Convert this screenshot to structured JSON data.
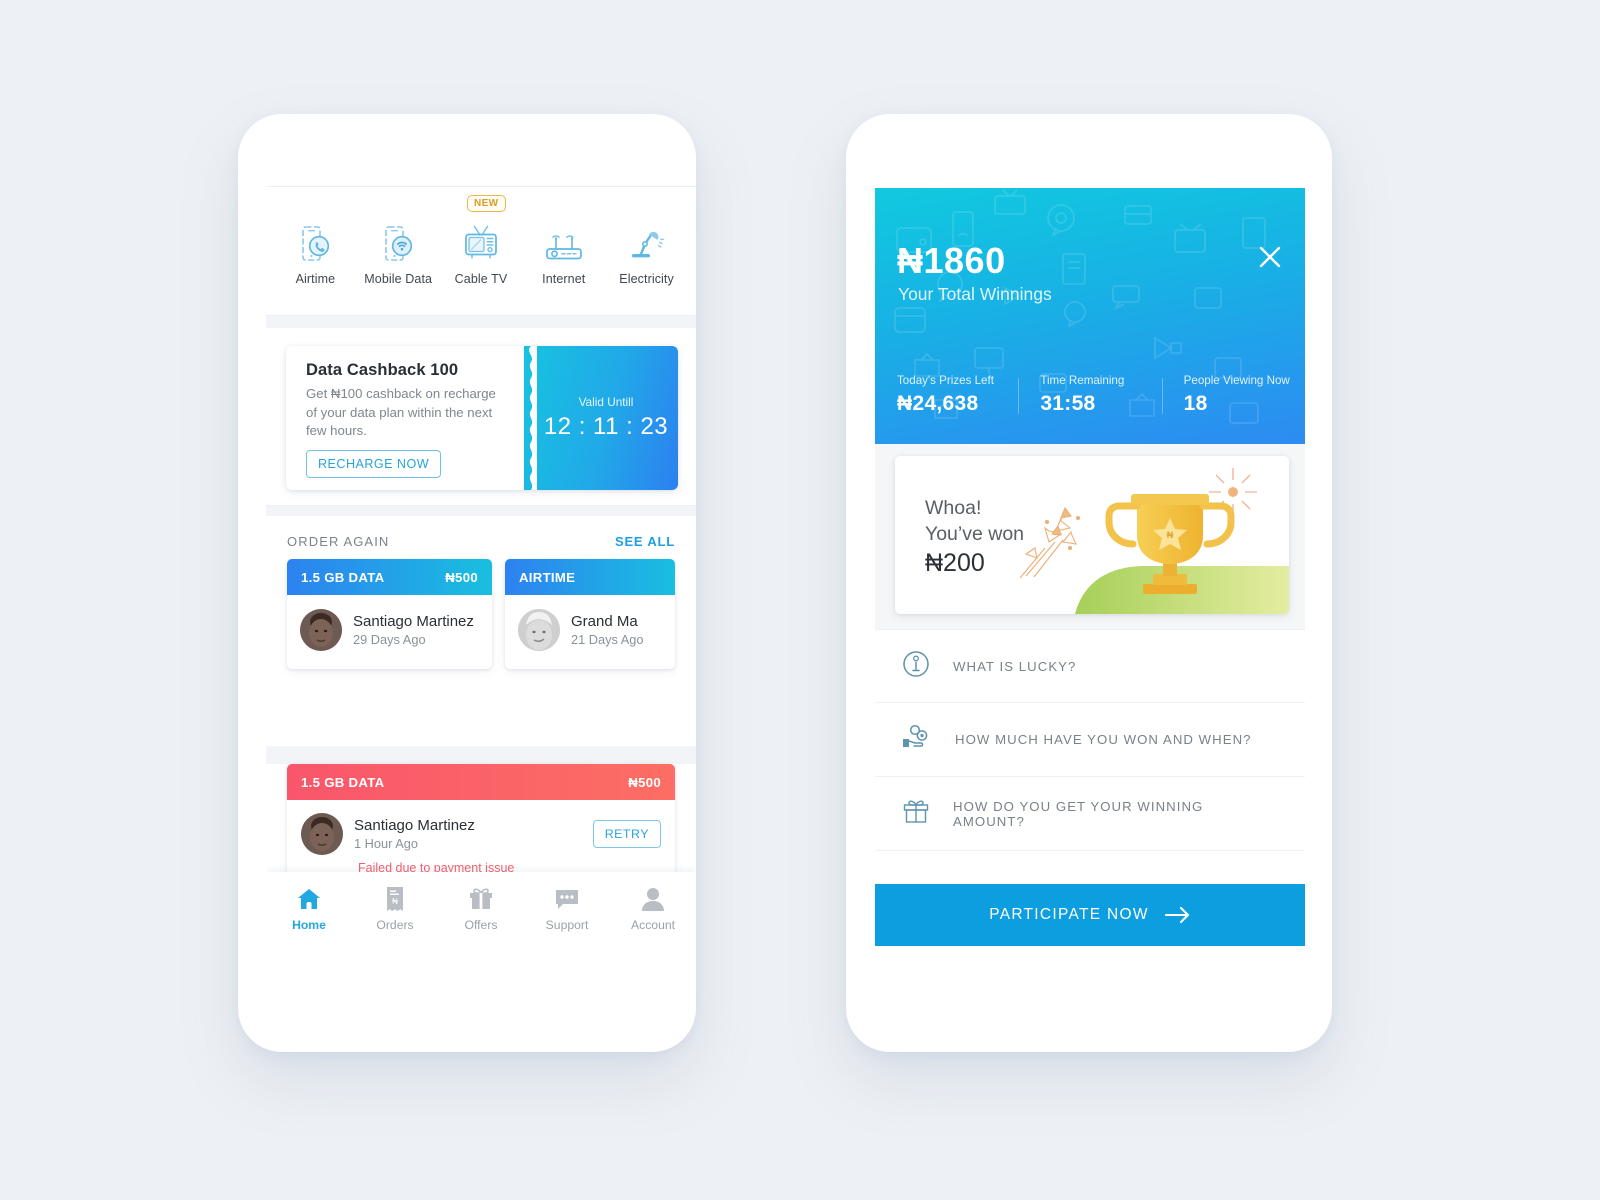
{
  "left_phone": {
    "services": [
      {
        "label": "Airtime",
        "icon": "phone-call-icon",
        "badge": null
      },
      {
        "label": "Mobile Data",
        "icon": "phone-wifi-icon",
        "badge": null
      },
      {
        "label": "Cable TV",
        "icon": "television-icon",
        "badge": "NEW"
      },
      {
        "label": "Internet",
        "icon": "router-icon",
        "badge": null
      },
      {
        "label": "Electricity",
        "icon": "desk-lamp-icon",
        "badge": null
      }
    ],
    "cashback": {
      "title": "Data Cashback 100",
      "description": "Get ₦100 cashback on recharge of your data plan within the next few hours.",
      "cta": "RECHARGE NOW",
      "valid_label": "Valid Untill",
      "countdown": "12 : 11 : 23"
    },
    "order_again": {
      "title": "ORDER AGAIN",
      "see_all": "SEE ALL",
      "cards": [
        {
          "type": "1.5 GB DATA",
          "amount": "₦500",
          "name": "Santiago Martinez",
          "time": "29 Days Ago",
          "status": "ok"
        },
        {
          "type": "AIRTIME",
          "amount": "",
          "name": "Grand Ma",
          "time": "21 Days Ago",
          "status": "ok"
        }
      ]
    },
    "failed_order": {
      "type": "1.5 GB DATA",
      "amount": "₦500",
      "name": "Santiago Martinez",
      "time": "1 Hour Ago",
      "error": "Failed due to payment issue",
      "retry_label": "RETRY"
    },
    "bottom_nav": [
      {
        "label": "Home",
        "icon": "home-icon",
        "active": true
      },
      {
        "label": "Orders",
        "icon": "receipt-icon",
        "active": false
      },
      {
        "label": "Offers",
        "icon": "gift-icon",
        "active": false
      },
      {
        "label": "Support",
        "icon": "chat-icon",
        "active": false
      },
      {
        "label": "Account",
        "icon": "person-icon",
        "active": false
      }
    ]
  },
  "right_phone": {
    "header": {
      "total_winnings": "₦1860",
      "total_winnings_label": "Your Total Winnings",
      "close_icon": "close-icon",
      "stats": [
        {
          "label": "Today's Prizes Left",
          "value": "₦24,638"
        },
        {
          "label": "Time Remaining",
          "value": "31:58"
        },
        {
          "label": "People Viewing Now",
          "value": "18"
        }
      ]
    },
    "won_card": {
      "line1": "Whoa!",
      "line2": "You’ve won",
      "amount": "₦200",
      "illustration": "trophy-icon"
    },
    "faq": [
      {
        "label": "WHAT IS LUCKY?",
        "icon": "info-circle-icon"
      },
      {
        "label": "HOW MUCH HAVE YOU WON AND WHEN?",
        "icon": "hand-coins-icon"
      },
      {
        "label": "HOW DO YOU GET YOUR WINNING AMOUNT?",
        "icon": "gift-icon"
      }
    ],
    "participate": {
      "label": "PARTICIPATE NOW",
      "icon": "arrow-right-icon"
    }
  },
  "colors": {
    "page_background": "#edf1f5",
    "accent_blue": "#1f9fe0",
    "gradient_cyan": "#19bfdf",
    "gradient_blue": "#2d82f0",
    "failed_red": "#f9566b",
    "badge_amber": "#e8b84b",
    "trophy_gold": "#f5c645",
    "grass_green": "#a8d05a"
  }
}
